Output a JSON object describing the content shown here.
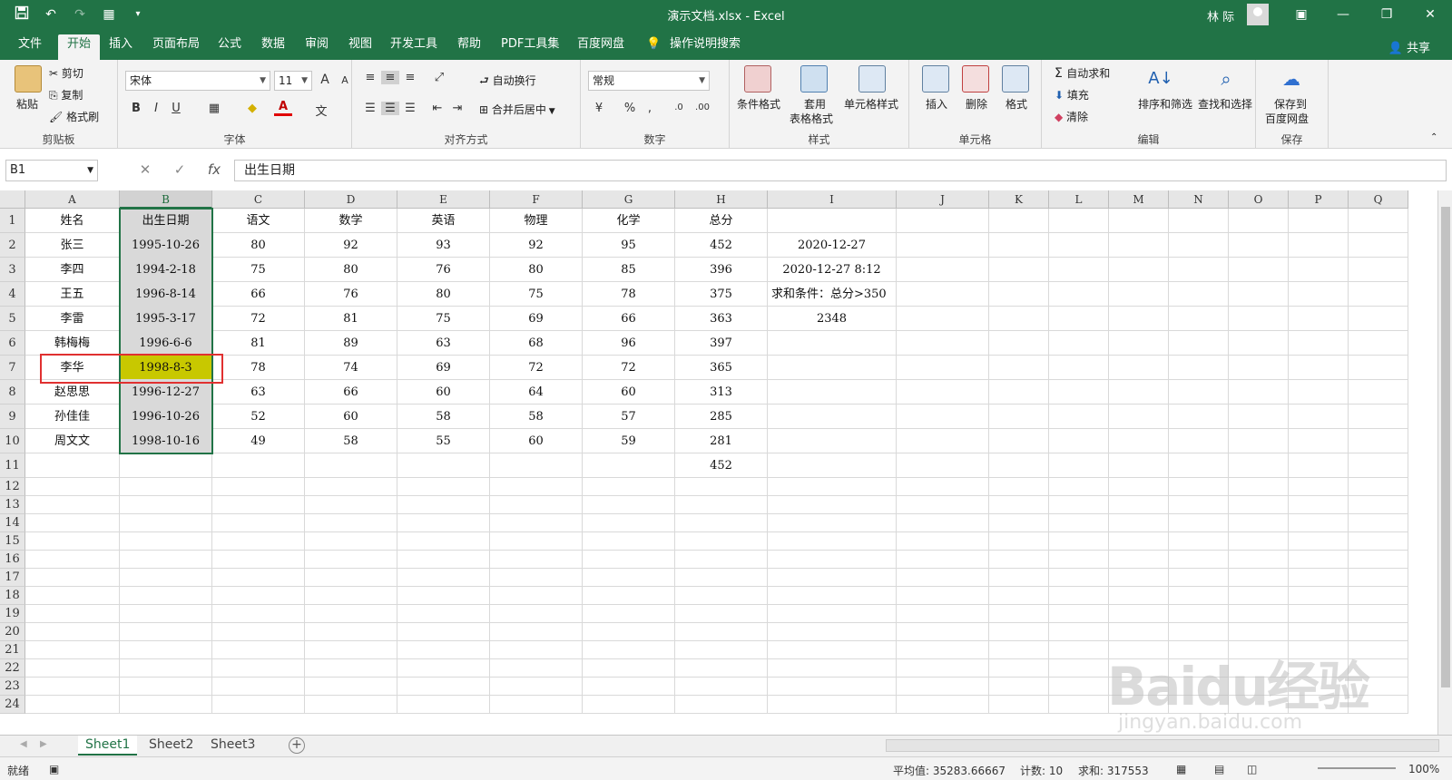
{
  "window": {
    "title": "演示文档.xlsx  -  Excel",
    "user": "林 际",
    "minimize_glyph": "—",
    "restore_glyph": "❐",
    "close_glyph": "✕",
    "ribbon_display_glyph": "▣"
  },
  "tabs": [
    "文件",
    "开始",
    "插入",
    "页面布局",
    "公式",
    "数据",
    "审阅",
    "视图",
    "开发工具",
    "帮助",
    "PDF工具集",
    "百度网盘"
  ],
  "active_tab": "开始",
  "tell_me": "操作说明搜索",
  "share": "共享",
  "ribbon": {
    "clipboard": {
      "label": "剪贴板",
      "paste": "粘贴",
      "cut": "剪切",
      "copy": "复制",
      "format_painter": "格式刷"
    },
    "font": {
      "label": "字体",
      "font_name": "宋体",
      "font_size": "11",
      "bold": "B",
      "italic": "I",
      "underline": "U",
      "grow": "A",
      "shrink": "A",
      "font_color_glyph": "A",
      "phonetic": "文"
    },
    "alignment": {
      "label": "对齐方式",
      "wrap_text": "自动换行",
      "merge_center": "合并后居中"
    },
    "number": {
      "label": "数字",
      "format": "常规",
      "percent": "%",
      "comma": ",",
      "inc_decimal": ".0",
      "dec_decimal": ".00"
    },
    "styles": {
      "label": "样式",
      "conditional": "条件格式",
      "table_format_1": "套用",
      "table_format_2": "表格格式",
      "cell_styles": "单元格样式"
    },
    "cells": {
      "label": "单元格",
      "insert": "插入",
      "delete": "删除",
      "format": "格式"
    },
    "editing": {
      "label": "编辑",
      "autosum": "自动求和",
      "fill": "填充",
      "clear": "清除",
      "sort_filter": "排序和筛选",
      "find_select": "查找和选择"
    },
    "save": {
      "label": "保存",
      "save_to_1": "保存到",
      "save_to_2": "百度网盘"
    }
  },
  "formula_bar": {
    "name_box": "B1",
    "cancel": "✕",
    "enter": "✓",
    "fx": "fx",
    "content": "出生日期"
  },
  "columns": [
    "A",
    "B",
    "C",
    "D",
    "E",
    "F",
    "G",
    "H",
    "I",
    "J",
    "K",
    "L",
    "M",
    "N",
    "O",
    "P",
    "Q"
  ],
  "rows": [
    [
      "姓名",
      "出生日期",
      "语文",
      "数学",
      "英语",
      "物理",
      "化学",
      "总分",
      "",
      "",
      "",
      "",
      "",
      "",
      "",
      "",
      ""
    ],
    [
      "张三",
      "1995-10-26",
      "80",
      "92",
      "93",
      "92",
      "95",
      "452",
      "2020-12-27",
      "",
      "",
      "",
      "",
      "",
      "",
      "",
      ""
    ],
    [
      "李四",
      "1994-2-18",
      "75",
      "80",
      "76",
      "80",
      "85",
      "396",
      "2020-12-27 8:12",
      "",
      "",
      "",
      "",
      "",
      "",
      "",
      ""
    ],
    [
      "王五",
      "1996-8-14",
      "66",
      "76",
      "80",
      "75",
      "78",
      "375",
      "求和条件：总分>350",
      "",
      "",
      "",
      "",
      "",
      "",
      "",
      ""
    ],
    [
      "李雷",
      "1995-3-17",
      "72",
      "81",
      "75",
      "69",
      "66",
      "363",
      "2348",
      "",
      "",
      "",
      "",
      "",
      "",
      "",
      ""
    ],
    [
      "韩梅梅",
      "1996-6-6",
      "81",
      "89",
      "63",
      "68",
      "96",
      "397",
      "",
      "",
      "",
      "",
      "",
      "",
      "",
      "",
      ""
    ],
    [
      "李华",
      "1998-8-3",
      "78",
      "74",
      "69",
      "72",
      "72",
      "365",
      "",
      "",
      "",
      "",
      "",
      "",
      "",
      "",
      ""
    ],
    [
      "赵思思",
      "1996-12-27",
      "63",
      "66",
      "60",
      "64",
      "60",
      "313",
      "",
      "",
      "",
      "",
      "",
      "",
      "",
      "",
      ""
    ],
    [
      "孙佳佳",
      "1996-10-26",
      "52",
      "60",
      "58",
      "58",
      "57",
      "285",
      "",
      "",
      "",
      "",
      "",
      "",
      "",
      "",
      ""
    ],
    [
      "周文文",
      "1998-10-16",
      "49",
      "58",
      "55",
      "60",
      "59",
      "281",
      "",
      "",
      "",
      "",
      "",
      "",
      "",
      "",
      ""
    ],
    [
      "",
      "",
      "",
      "",
      "",
      "",
      "",
      "452",
      "",
      "",
      "",
      "",
      "",
      "",
      "",
      "",
      ""
    ]
  ],
  "row_numbers": [
    "1",
    "2",
    "3",
    "4",
    "5",
    "6",
    "7",
    "8",
    "9",
    "10",
    "11",
    "12",
    "13",
    "14",
    "15",
    "16",
    "17",
    "18",
    "19",
    "20",
    "21",
    "22",
    "23",
    "24"
  ],
  "sheets": [
    "Sheet1",
    "Sheet2",
    "Sheet3"
  ],
  "active_sheet": "Sheet1",
  "add_sheet_glyph": "+",
  "status": {
    "ready": "就绪",
    "average": "平均值: 35283.66667",
    "count": "计数: 10",
    "sum": "求和: 317553",
    "zoom": "100%"
  },
  "watermark": {
    "main": "Baidu经验",
    "sub": "jingyan.baidu.com"
  },
  "colors": {
    "excel_green": "#217346",
    "highlight_yellow": "#c8c800",
    "red_box": "#e03030"
  }
}
